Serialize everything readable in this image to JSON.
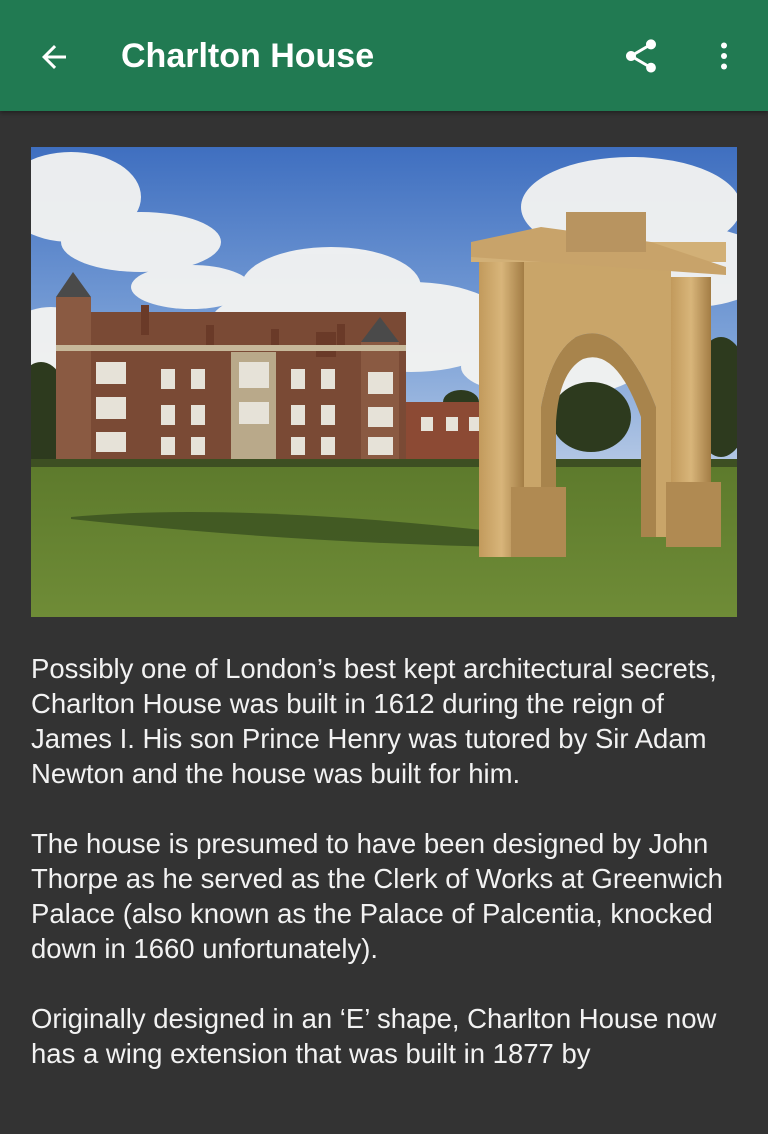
{
  "app_bar": {
    "title": "Charlton House",
    "background": "#217a52",
    "back_icon": "arrow-left-icon",
    "share_icon": "share-icon",
    "more_icon": "more-vert-icon"
  },
  "article": {
    "image_icon": "photo-charlton-house",
    "paragraphs": [
      "Possibly one of London’s best kept architectural secrets, Charlton House was built in 1612 during the reign of James I. His son Prince Henry was tutored by Sir Adam Newton and the house was built for him.",
      "The house is presumed to have been designed by John Thorpe as he served as the Clerk of Works at Greenwich Palace (also known as the Palace of Palcentia, knocked down in 1660 unfortunately).",
      "Originally designed in an ‘E’ shape, Charlton House now has a wing extension that was built in 1877 by"
    ]
  }
}
